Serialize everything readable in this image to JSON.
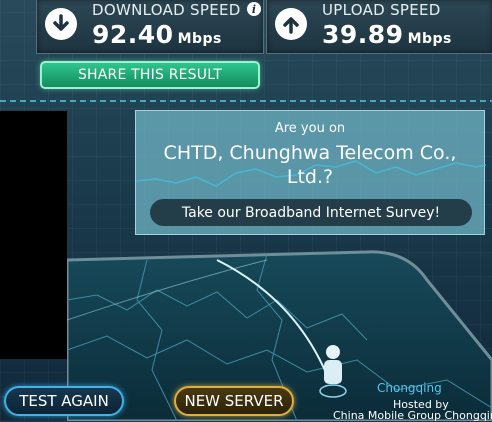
{
  "download": {
    "label": "DOWNLOAD SPEED",
    "value": "92.40",
    "unit": "Mbps"
  },
  "upload": {
    "label": "UPLOAD SPEED",
    "value": "39.89",
    "unit": "Mbps"
  },
  "share_button": "SHARE THIS RESULT",
  "survey": {
    "question_line1": "Are you on",
    "question_line2": "CHTD, Chunghwa Telecom Co.,",
    "question_line3": "Ltd.?",
    "button": "Take our Broadband Internet Survey!"
  },
  "buttons": {
    "test_again": "TEST AGAIN",
    "new_server": "NEW SERVER"
  },
  "server": {
    "city": "Chongqing",
    "hosted_by": "Hosted by",
    "host": "China Mobile Group Chongqing"
  },
  "icons": {
    "info": "i",
    "download": "download-arrow-icon",
    "upload": "upload-arrow-icon",
    "person": "person-icon"
  },
  "colors": {
    "accent_green": "#2ec58e",
    "accent_blue": "#3fb2e6",
    "accent_gold": "#e0b13a",
    "city": "#52c7ef"
  }
}
